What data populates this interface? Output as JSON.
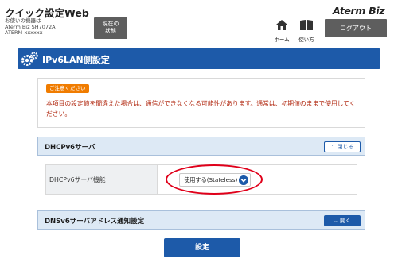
{
  "header": {
    "app_title": "クイック設定Web",
    "device_info": [
      "お使いの機器は",
      "Aterm Biz SH7072A",
      "ATERM-xxxxxx"
    ],
    "status_button": [
      "現在の",
      "状態"
    ],
    "brand": "Aterm Biz",
    "home_label": "ホーム",
    "help_label": "使い方",
    "logout_label": "ログアウト"
  },
  "page": {
    "title": "IPv6LAN側設定"
  },
  "caution": {
    "badge": "ご注意ください",
    "text": "本項目の設定値を間違えた場合は、通信ができなくなる可能性があります。通常は、初期値のままで使用してください。"
  },
  "dhcp_section": {
    "title": "DHCPv6サーバ",
    "toggle_label": "閉じる",
    "row_label": "DHCPv6サーバ機能",
    "select_value": "使用する(Stateless)"
  },
  "dns_section": {
    "title": "DNSv6サーバアドレス通知設定",
    "toggle_label": "開く"
  },
  "actions": {
    "submit_label": "設定"
  },
  "colors": {
    "accent": "#1d5aa9",
    "caution_badge": "#f07c00",
    "caution_text": "#b22a12",
    "highlight": "#e0001a"
  }
}
